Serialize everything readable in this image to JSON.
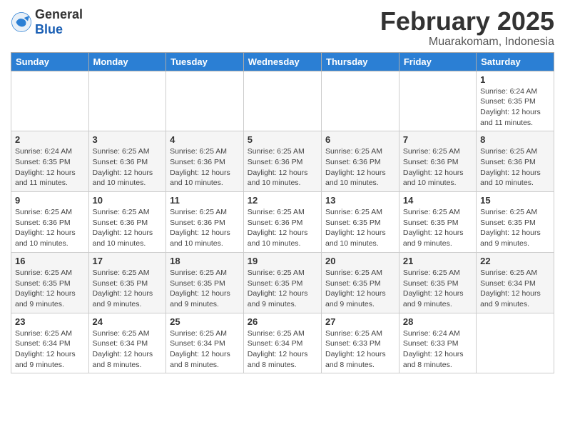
{
  "logo": {
    "general": "General",
    "blue": "Blue"
  },
  "title": "February 2025",
  "location": "Muarakomam, Indonesia",
  "days_of_week": [
    "Sunday",
    "Monday",
    "Tuesday",
    "Wednesday",
    "Thursday",
    "Friday",
    "Saturday"
  ],
  "weeks": [
    [
      {
        "day": "",
        "info": ""
      },
      {
        "day": "",
        "info": ""
      },
      {
        "day": "",
        "info": ""
      },
      {
        "day": "",
        "info": ""
      },
      {
        "day": "",
        "info": ""
      },
      {
        "day": "",
        "info": ""
      },
      {
        "day": "1",
        "info": "Sunrise: 6:24 AM\nSunset: 6:35 PM\nDaylight: 12 hours\nand 11 minutes."
      }
    ],
    [
      {
        "day": "2",
        "info": "Sunrise: 6:24 AM\nSunset: 6:35 PM\nDaylight: 12 hours\nand 11 minutes."
      },
      {
        "day": "3",
        "info": "Sunrise: 6:25 AM\nSunset: 6:36 PM\nDaylight: 12 hours\nand 10 minutes."
      },
      {
        "day": "4",
        "info": "Sunrise: 6:25 AM\nSunset: 6:36 PM\nDaylight: 12 hours\nand 10 minutes."
      },
      {
        "day": "5",
        "info": "Sunrise: 6:25 AM\nSunset: 6:36 PM\nDaylight: 12 hours\nand 10 minutes."
      },
      {
        "day": "6",
        "info": "Sunrise: 6:25 AM\nSunset: 6:36 PM\nDaylight: 12 hours\nand 10 minutes."
      },
      {
        "day": "7",
        "info": "Sunrise: 6:25 AM\nSunset: 6:36 PM\nDaylight: 12 hours\nand 10 minutes."
      },
      {
        "day": "8",
        "info": "Sunrise: 6:25 AM\nSunset: 6:36 PM\nDaylight: 12 hours\nand 10 minutes."
      }
    ],
    [
      {
        "day": "9",
        "info": "Sunrise: 6:25 AM\nSunset: 6:36 PM\nDaylight: 12 hours\nand 10 minutes."
      },
      {
        "day": "10",
        "info": "Sunrise: 6:25 AM\nSunset: 6:36 PM\nDaylight: 12 hours\nand 10 minutes."
      },
      {
        "day": "11",
        "info": "Sunrise: 6:25 AM\nSunset: 6:36 PM\nDaylight: 12 hours\nand 10 minutes."
      },
      {
        "day": "12",
        "info": "Sunrise: 6:25 AM\nSunset: 6:36 PM\nDaylight: 12 hours\nand 10 minutes."
      },
      {
        "day": "13",
        "info": "Sunrise: 6:25 AM\nSunset: 6:35 PM\nDaylight: 12 hours\nand 10 minutes."
      },
      {
        "day": "14",
        "info": "Sunrise: 6:25 AM\nSunset: 6:35 PM\nDaylight: 12 hours\nand 9 minutes."
      },
      {
        "day": "15",
        "info": "Sunrise: 6:25 AM\nSunset: 6:35 PM\nDaylight: 12 hours\nand 9 minutes."
      }
    ],
    [
      {
        "day": "16",
        "info": "Sunrise: 6:25 AM\nSunset: 6:35 PM\nDaylight: 12 hours\nand 9 minutes."
      },
      {
        "day": "17",
        "info": "Sunrise: 6:25 AM\nSunset: 6:35 PM\nDaylight: 12 hours\nand 9 minutes."
      },
      {
        "day": "18",
        "info": "Sunrise: 6:25 AM\nSunset: 6:35 PM\nDaylight: 12 hours\nand 9 minutes."
      },
      {
        "day": "19",
        "info": "Sunrise: 6:25 AM\nSunset: 6:35 PM\nDaylight: 12 hours\nand 9 minutes."
      },
      {
        "day": "20",
        "info": "Sunrise: 6:25 AM\nSunset: 6:35 PM\nDaylight: 12 hours\nand 9 minutes."
      },
      {
        "day": "21",
        "info": "Sunrise: 6:25 AM\nSunset: 6:35 PM\nDaylight: 12 hours\nand 9 minutes."
      },
      {
        "day": "22",
        "info": "Sunrise: 6:25 AM\nSunset: 6:34 PM\nDaylight: 12 hours\nand 9 minutes."
      }
    ],
    [
      {
        "day": "23",
        "info": "Sunrise: 6:25 AM\nSunset: 6:34 PM\nDaylight: 12 hours\nand 9 minutes."
      },
      {
        "day": "24",
        "info": "Sunrise: 6:25 AM\nSunset: 6:34 PM\nDaylight: 12 hours\nand 8 minutes."
      },
      {
        "day": "25",
        "info": "Sunrise: 6:25 AM\nSunset: 6:34 PM\nDaylight: 12 hours\nand 8 minutes."
      },
      {
        "day": "26",
        "info": "Sunrise: 6:25 AM\nSunset: 6:34 PM\nDaylight: 12 hours\nand 8 minutes."
      },
      {
        "day": "27",
        "info": "Sunrise: 6:25 AM\nSunset: 6:33 PM\nDaylight: 12 hours\nand 8 minutes."
      },
      {
        "day": "28",
        "info": "Sunrise: 6:24 AM\nSunset: 6:33 PM\nDaylight: 12 hours\nand 8 minutes."
      },
      {
        "day": "",
        "info": ""
      }
    ]
  ]
}
